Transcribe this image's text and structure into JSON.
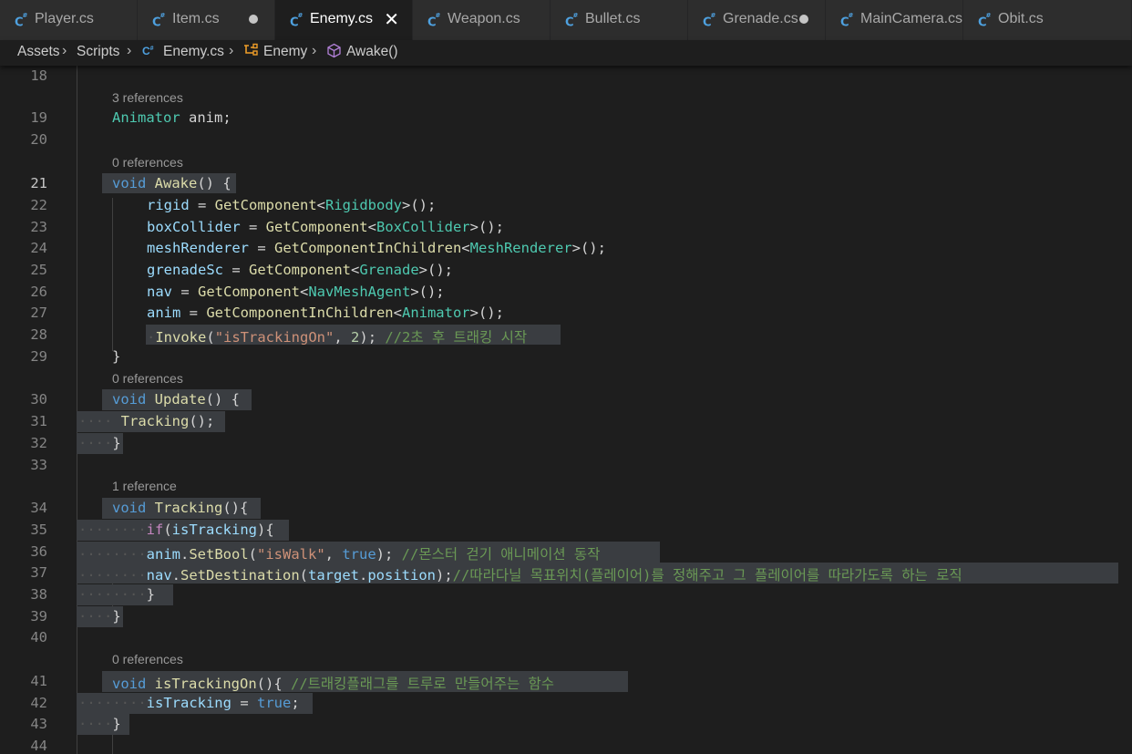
{
  "tabs": [
    {
      "label": "Player.cs",
      "state": "normal"
    },
    {
      "label": "Item.cs",
      "state": "modified"
    },
    {
      "label": "Enemy.cs",
      "state": "active"
    },
    {
      "label": "Weapon.cs",
      "state": "normal"
    },
    {
      "label": "Bullet.cs",
      "state": "normal"
    },
    {
      "label": "Grenade.cs",
      "state": "modified"
    },
    {
      "label": "MainCamera.cs",
      "state": "normal"
    },
    {
      "label": "Obit.cs",
      "state": "normal"
    }
  ],
  "breadcrumb": {
    "assets": "Assets",
    "scripts": "Scripts",
    "file": "Enemy.cs",
    "class": "Enemy",
    "method": "Awake()"
  },
  "editor": {
    "current_line": "21",
    "lines": [
      {
        "n": "18",
        "code": ""
      },
      {
        "n": "19",
        "code": "Animator anim;",
        "lens": "3 references"
      },
      {
        "n": "20",
        "code": ""
      },
      {
        "n": "21",
        "code": "void Awake() {",
        "lens": "0 references"
      },
      {
        "n": "22",
        "code": "    rigid = GetComponent<Rigidbody>();"
      },
      {
        "n": "23",
        "code": "    boxCollider = GetComponent<BoxCollider>();"
      },
      {
        "n": "24",
        "code": "    meshRenderer = GetComponentInChildren<MeshRenderer>();"
      },
      {
        "n": "25",
        "code": "    grenadeSc = GetComponent<Grenade>();"
      },
      {
        "n": "26",
        "code": "    nav = GetComponent<NavMeshAgent>();"
      },
      {
        "n": "27",
        "code": "    anim = GetComponentInChildren<Animator>();"
      },
      {
        "n": "28",
        "code": "    Invoke(\"isTrackingOn\", 2); //2초 후 트래킹 시작"
      },
      {
        "n": "29",
        "code": "}"
      },
      {
        "n": "30",
        "code": "void Update() {",
        "lens": "0 references"
      },
      {
        "n": "31",
        "code": "    Tracking();"
      },
      {
        "n": "32",
        "code": "}"
      },
      {
        "n": "33",
        "code": ""
      },
      {
        "n": "34",
        "code": "void Tracking(){",
        "lens": "1 reference"
      },
      {
        "n": "35",
        "code": "    if(isTracking){"
      },
      {
        "n": "36",
        "code": "    anim.SetBool(\"isWalk\", true); //몬스터 걷기 애니메이션 동작"
      },
      {
        "n": "37",
        "code": "    nav.SetDestination(target.position);//따라다닐 목표위치(플레이어)를 정해주고 그 플레이어를 따라가도록 하는 로직"
      },
      {
        "n": "38",
        "code": "    }"
      },
      {
        "n": "39",
        "code": "}"
      },
      {
        "n": "40",
        "code": ""
      },
      {
        "n": "41",
        "code": "void isTrackingOn(){ //트래킹플래그를 트루로 만들어주는 함수",
        "lens": "0 references"
      },
      {
        "n": "42",
        "code": "    isTracking = true;"
      },
      {
        "n": "43",
        "code": "}"
      },
      {
        "n": "44",
        "code": ""
      }
    ]
  }
}
